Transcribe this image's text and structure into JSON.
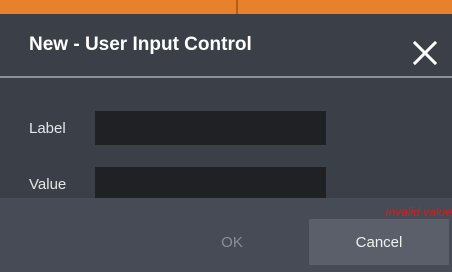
{
  "dialog": {
    "title": "New - User Input Control",
    "close_icon": "close-icon"
  },
  "form": {
    "label_label": "Label",
    "label_value": "",
    "value_label": "Value",
    "value_value": ""
  },
  "footer": {
    "error_text": "Invalid value",
    "ok_label": "OK",
    "cancel_label": "Cancel"
  },
  "colors": {
    "accent": "#e8822a",
    "error": "#d02020"
  }
}
